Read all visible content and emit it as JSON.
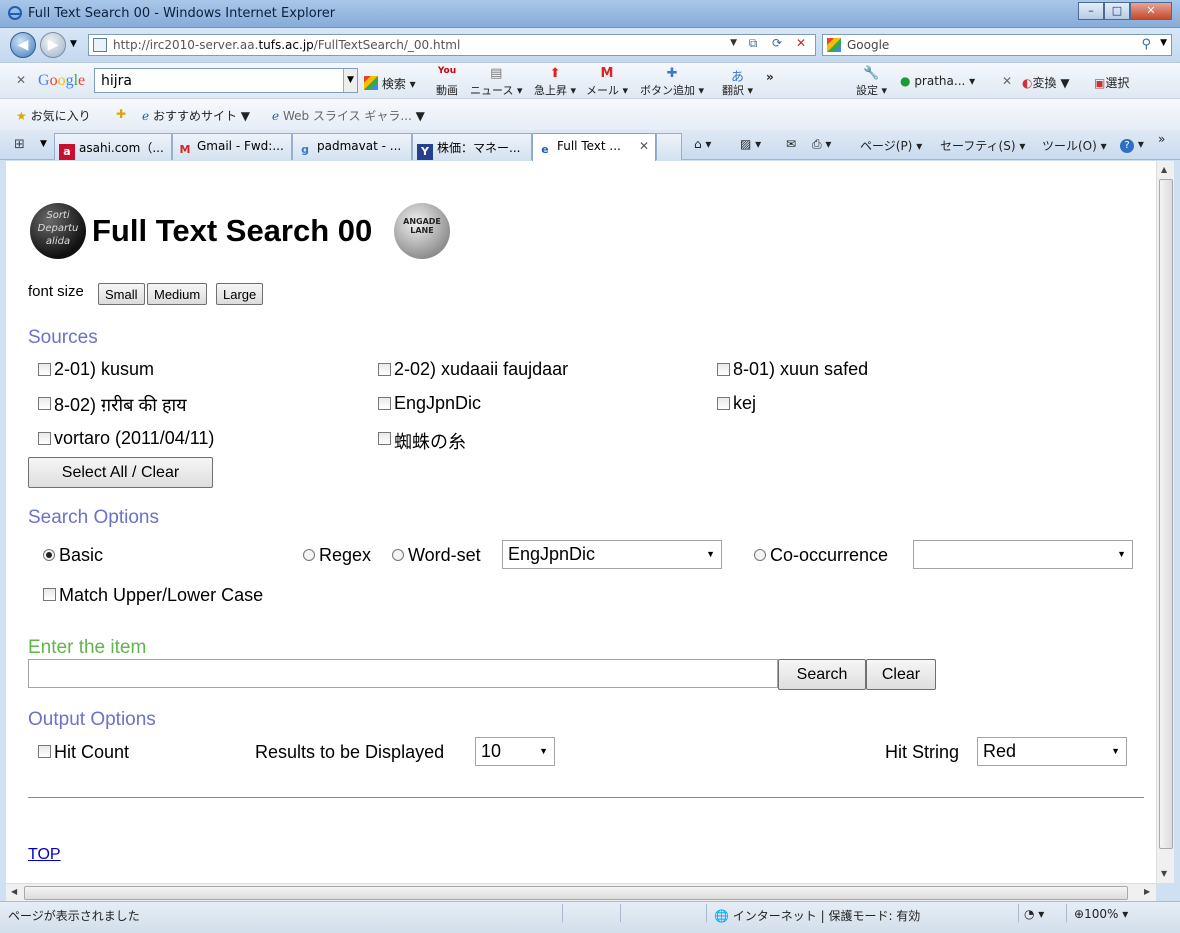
{
  "window": {
    "title": "Full Text Search 00 - Windows Internet Explorer",
    "min": "–",
    "max": "□",
    "close": "✕"
  },
  "address": {
    "url_pre": "http://irc2010-server.aa.",
    "url_host": "tufs.ac.jp",
    "url_post": "/FullTextSearch/_00.html",
    "search_placeholder": "Google"
  },
  "google_toolbar": {
    "logo": "Google",
    "query": "hijra",
    "search_label": "検索",
    "items": [
      "動画",
      "ニュース",
      "急上昇",
      "メール",
      "ボタン追加",
      "翻訳"
    ],
    "more": "»",
    "settings": "設定",
    "profile": "pratha...",
    "convert": "変換",
    "select": "選択"
  },
  "favorites": {
    "favorites_label": "お気に入り",
    "suggested": "おすすめサイト",
    "webslice": "Web スライス ギャラ..."
  },
  "tabs": [
    {
      "label": "asahi.com（...",
      "icon": "a"
    },
    {
      "label": "Gmail - Fwd:...",
      "icon": "M"
    },
    {
      "label": "padmavat - ...",
      "icon": "g"
    },
    {
      "label": "株価：マネー...",
      "icon": "Y"
    },
    {
      "label": "Full Text ...",
      "icon": "e",
      "active": true
    }
  ],
  "commands": {
    "page": "ページ(P)",
    "safety": "セーフティ(S)",
    "tools": "ツール(O)",
    "help": "?"
  },
  "page": {
    "title": "Full Text Search 00",
    "logo_left_text": "Sorti\nDepartu\nalida",
    "logo_right_text": "ANGADE LANE",
    "font_size_label": "font size",
    "font_buttons": [
      "Small",
      "Medium",
      "Large"
    ],
    "sources_heading": "Sources",
    "sources": [
      "2-01) kusum",
      "2-02) xudaaii faujdaar",
      "8-01) xuun safed",
      "8-02) ग़रीब की हाय",
      "EngJpnDic",
      "kej",
      "vortaro (2011/04/11)",
      "蜘蛛の糸"
    ],
    "select_all_label": "Select All / Clear",
    "search_options_heading": "Search Options",
    "modes": {
      "basic": "Basic",
      "regex": "Regex",
      "wordset": "Word-set",
      "cooccurrence": "Co-occurrence",
      "selected": "basic"
    },
    "wordset_value": "EngJpnDic",
    "cooccurrence_value": "",
    "match_case_label": "Match Upper/Lower Case",
    "enter_item_heading": "Enter the item",
    "item_value": "",
    "search_button": "Search",
    "clear_button": "Clear",
    "output_heading": "Output Options",
    "hit_count_label": "Hit Count",
    "results_label": "Results to be Displayed",
    "results_value": "10",
    "hit_string_label": "Hit String",
    "hit_string_value": "Red",
    "top_link": "TOP"
  },
  "status": {
    "text": "ページが表示されました",
    "zone": "インターネット | 保護モード: 有効",
    "zoom": "100%"
  },
  "colors": {
    "section": "#6b72c8",
    "enter_item": "#5fb64a",
    "link": "#0000cc"
  }
}
